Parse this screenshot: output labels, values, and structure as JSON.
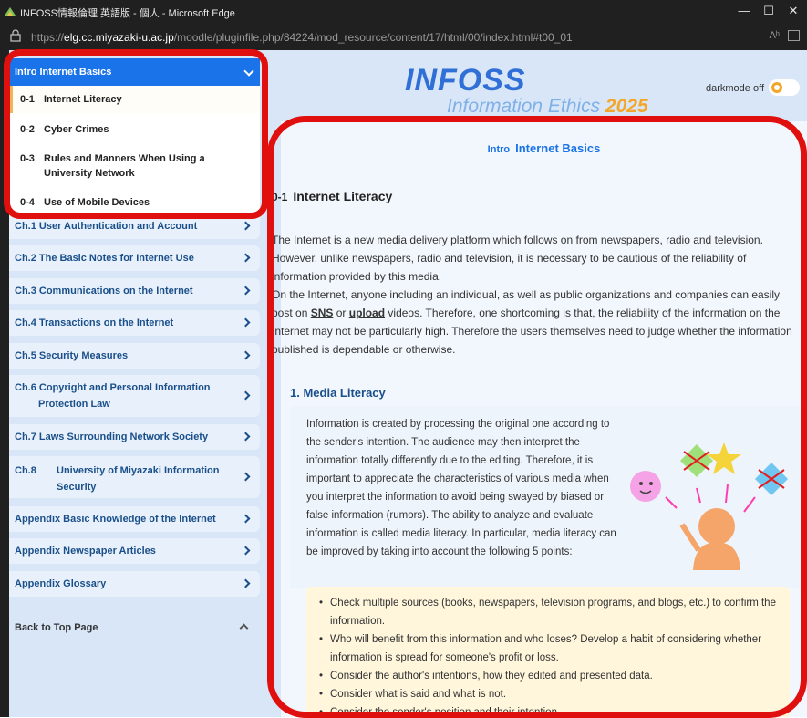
{
  "window": {
    "title": "INFOSS情報倫理 英語版 - 個人 - Microsoft Edge",
    "minimize": "—",
    "maximize": "☐",
    "close": "✕"
  },
  "address": {
    "prefix": "https://",
    "host": "elg.cc.miyazaki-u.ac.jp",
    "path": "/moodle/pluginfile.php/84224/mod_resource/content/17/html/00/index.html#t00_01",
    "read_aloud": "Aʰ"
  },
  "sidebar": {
    "intro_header": "Intro Internet Basics",
    "sub_items": [
      {
        "num": "0-1",
        "label": "Internet Literacy"
      },
      {
        "num": "0-2",
        "label": "Cyber Crimes"
      },
      {
        "num": "0-3",
        "label": "Rules and Manners When Using a University Network"
      },
      {
        "num": "0-4",
        "label": "Use of Mobile Devices"
      }
    ],
    "chapters": [
      {
        "label": "Ch.1 User Authentication and Account"
      },
      {
        "label": "Ch.2 The Basic Notes for Internet Use"
      },
      {
        "label": "Ch.3 Communications on the Internet"
      },
      {
        "label": "Ch.4 Transactions on the Internet"
      },
      {
        "label": "Ch.5 Security Measures"
      },
      {
        "label": "Ch.6 Copyright and Personal Information",
        "label2": "Protection Law"
      },
      {
        "label": "Ch.7 Laws Surrounding Network Society"
      },
      {
        "label": "Ch.8",
        "label_mid": "University of Miyazaki Information",
        "label2": "Security"
      },
      {
        "label": "Appendix  Basic Knowledge of the Internet"
      },
      {
        "label": "Appendix  Newspaper Articles"
      },
      {
        "label": "Appendix  Glossary"
      }
    ],
    "back_to_top": "Back to Top Page"
  },
  "header": {
    "logo_main": "INFOSS",
    "logo_sub": "Information Ethics",
    "logo_year": "2025",
    "darkmode_label": "darkmode off"
  },
  "content": {
    "section_small": "Intro",
    "section_title": "Internet Basics",
    "sub_num": "0-1",
    "sub_title": "Internet Literacy",
    "para1": "The Internet is a new media delivery platform which follows on from newspapers, radio and television. However, unlike newspapers, radio and television, it is necessary to be cautious of the reliability of information provided by this media.",
    "para2_start": "On the Internet, anyone including an individual, as well as public organizations and companies can easily post on ",
    "sns": "SNS",
    "or": " or ",
    "upload": "upload",
    "para2_end": " videos. Therefore, one shortcoming is that, the reliability of the information on the Internet may not be particularly high. Therefore the users themselves need to judge whether the information published is dependable or otherwise.",
    "media_heading": "1. Media Literacy",
    "media_text": "Information is created by processing the original one according to the sender's intention. The audience may then interpret the information totally differently due to the editing. Therefore, it is important to appreciate the characteristics of various media when you interpret the information to avoid being swayed by biased or false information (rumors). The ability to analyze and evaluate information is called media literacy. In particular, media literacy can be improved by taking into account the following 5 points:",
    "tips": [
      "Check multiple sources (books, newspapers, television programs, and blogs, etc.) to confirm the information.",
      "Who will benefit from this information and who loses? Develop a habit of considering whether information is spread for someone's profit or loss.",
      "Consider the author's intentions, how they edited and presented data.",
      "Consider what is said and what is not.",
      "Consider the sender's position and their intention."
    ]
  },
  "colors": {
    "accent": "#1a73e8",
    "highlight": "#e0100f",
    "sidebar_bg": "#d8e6f7",
    "tips_bg": "#fff6dc"
  }
}
